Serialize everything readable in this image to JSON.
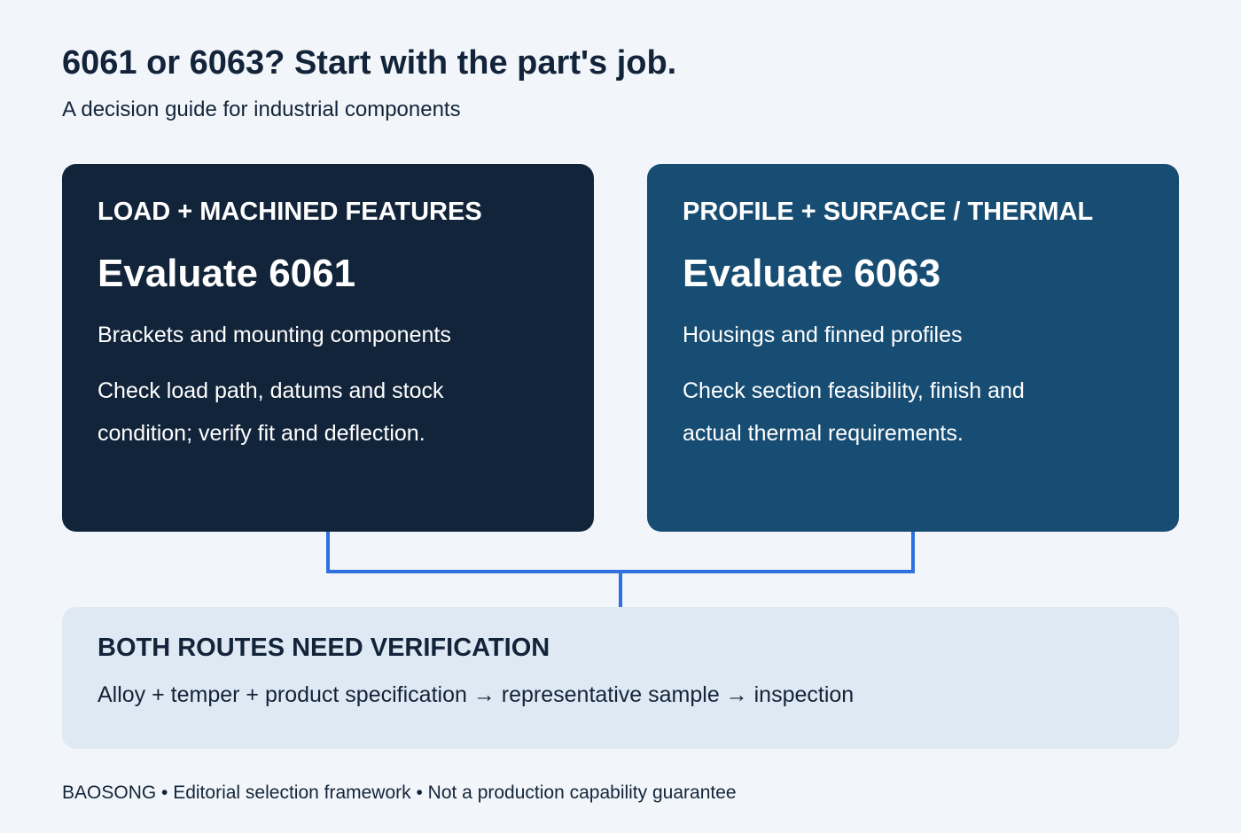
{
  "header": {
    "title": "6061 or 6063? Start with the part's job.",
    "subtitle": "A decision guide for industrial components"
  },
  "cards": [
    {
      "kicker": "LOAD + MACHINED FEATURES",
      "heading": "Evaluate 6061",
      "line1": "Brackets and mounting components",
      "line2": "Check load path, datums and stock condition; verify fit and deflection.",
      "bg_color": "#12243a"
    },
    {
      "kicker": "PROFILE + SURFACE / THERMAL",
      "heading": "Evaluate 6063",
      "line1": "Housings and finned profiles",
      "line2": "Check section feasibility, finish and actual thermal requirements.",
      "bg_color": "#184d73"
    }
  ],
  "verification": {
    "title": "BOTH ROUTES NEED VERIFICATION",
    "text": "Alloy + temper + product specification → representative sample → inspection"
  },
  "footer": {
    "text": "BAOSONG • Editorial selection framework • Not a production capability guarantee"
  },
  "colors": {
    "page_bg": "#f2f6fa",
    "text_dark": "#13243a",
    "connector": "#2f6fe0",
    "verification_bg": "#dfe9f3"
  }
}
